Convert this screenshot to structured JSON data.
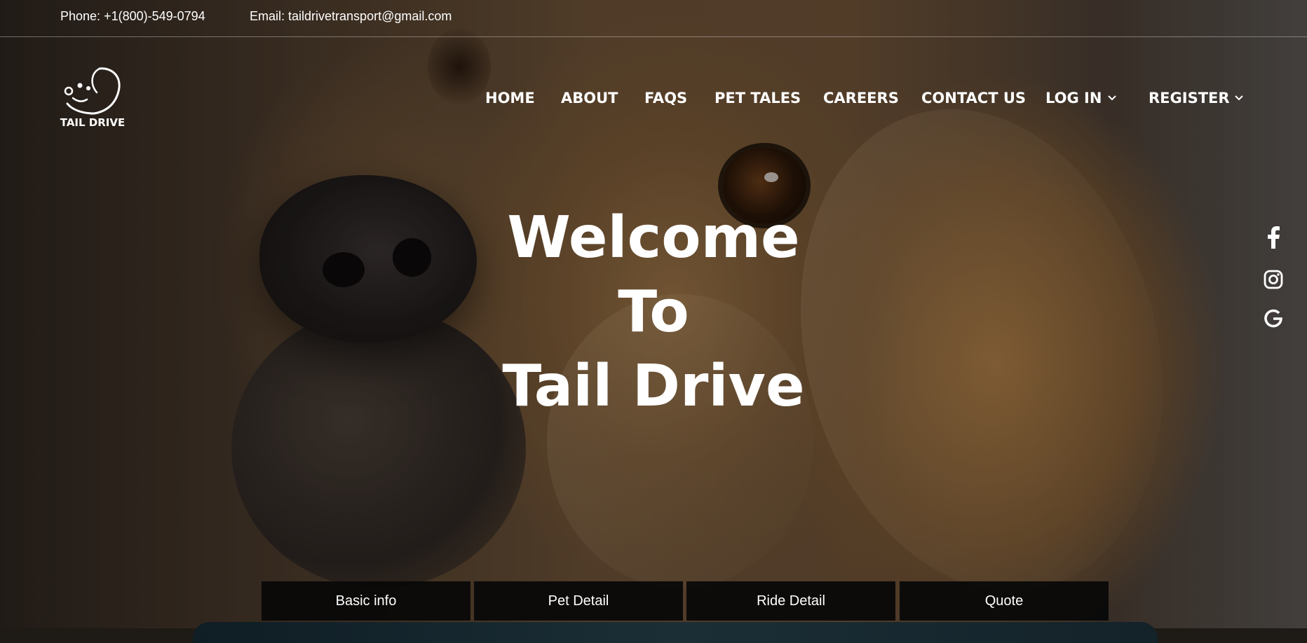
{
  "topbar": {
    "phone": "Phone: +1(800)-549-0794",
    "email": "Email: taildrivetransport@gmail.com"
  },
  "logo": {
    "text": "TAIL DRIVE"
  },
  "nav": {
    "items": [
      {
        "label": "HOME"
      },
      {
        "label": "ABOUT"
      },
      {
        "label": "FAQS"
      },
      {
        "label": "PET TALES"
      },
      {
        "label": "CAREERS"
      },
      {
        "label": "CONTACT US"
      },
      {
        "label": "LOG IN",
        "dropdown": true
      },
      {
        "label": "REGISTER",
        "dropdown": true
      }
    ]
  },
  "hero": {
    "line1": "Welcome",
    "line2": "To",
    "line3": "Tail Drive"
  },
  "social": [
    {
      "icon": "facebook-icon"
    },
    {
      "icon": "instagram-icon"
    },
    {
      "icon": "google-icon"
    }
  ],
  "steps": [
    {
      "label": "Basic info"
    },
    {
      "label": "Pet Detail"
    },
    {
      "label": "Ride Detail"
    },
    {
      "label": "Quote"
    }
  ],
  "colors": {
    "text": "#ffffff",
    "step_bg": "#080808"
  }
}
